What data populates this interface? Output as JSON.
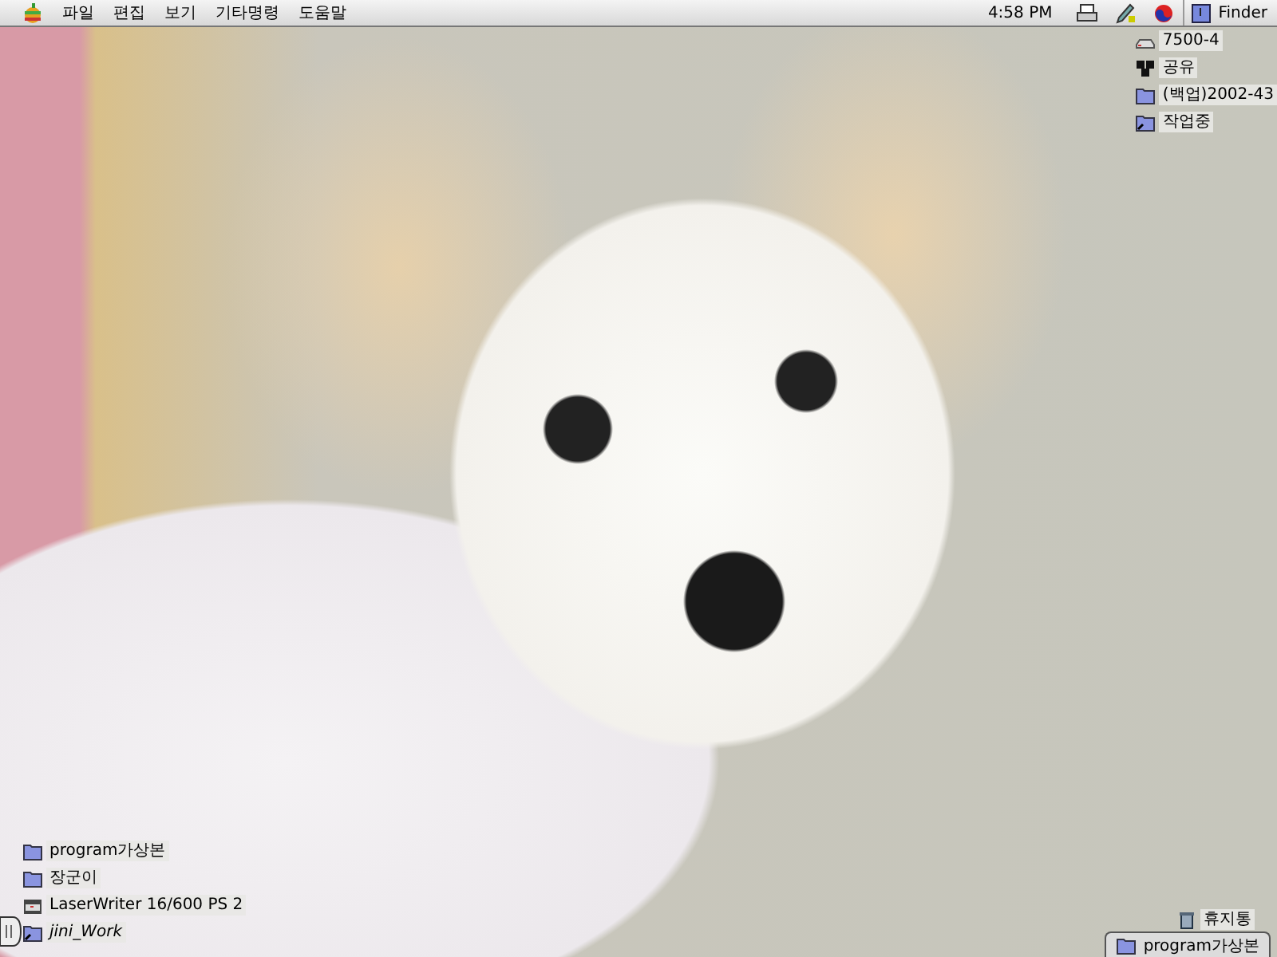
{
  "menu_bar": {
    "menus": [
      "파일",
      "편집",
      "보기",
      "기타명령",
      "도움말"
    ],
    "clock": "4:58 PM",
    "app": "Finder"
  },
  "desktop_icons_right": [
    {
      "label": "7500-4",
      "kind": "disk"
    },
    {
      "label": "공유",
      "kind": "share"
    },
    {
      "label": "(백업)2002-43",
      "kind": "folder"
    },
    {
      "label": "작업중",
      "kind": "alias"
    }
  ],
  "desktop_icons_left": [
    {
      "label": "program가상본",
      "kind": "folder"
    },
    {
      "label": "장군이",
      "kind": "folder"
    },
    {
      "label": "LaserWriter 16/600 PS 2",
      "kind": "printer"
    },
    {
      "label": "jini_Work",
      "kind": "alias"
    }
  ],
  "trash": {
    "label": "휴지통"
  },
  "collapsed_window": {
    "title": "program가상본"
  }
}
